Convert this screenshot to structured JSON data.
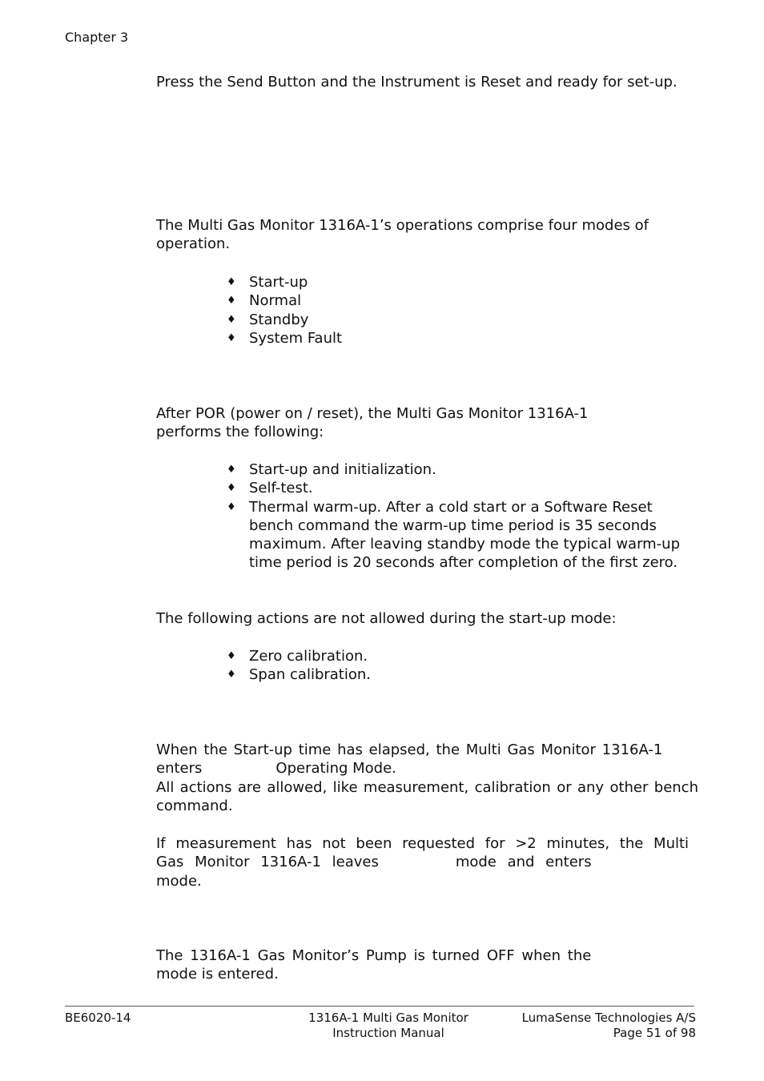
{
  "header": {
    "chapter": "Chapter 3"
  },
  "intro": {
    "reset_text": "Press the Send Button and the Instrument is Reset and ready for set-up."
  },
  "modes_section": {
    "intro": "The Multi Gas Monitor 1316A-1’s operations comprise four modes of operation.",
    "bullet_glyph": "♦",
    "modes": [
      "Start-up",
      "Normal",
      "Standby",
      "System Fault"
    ]
  },
  "startup_section": {
    "intro": "After POR (power on / reset), the Multi Gas Monitor 1316A-1 performs the following:",
    "steps": [
      "Start-up and initialization.",
      "Self-test.",
      "Thermal warm-up. After a cold start or a Software Reset bench command the warm-up time period is 35 seconds maximum. After leaving standby mode the typical warm-up time period is 20 seconds after completion of the first zero."
    ],
    "not_allowed_intro": "The following actions are not allowed during the start-up mode:",
    "not_allowed": [
      "Zero calibration.",
      "Span calibration."
    ]
  },
  "normal_section": {
    "line1": "When the Start-up time has elapsed, the Multi Gas Monitor 1316A-1",
    "line2_a": "enters",
    "line2_b": "Operating Mode.",
    "allowed": "All actions are allowed, like measurement, calibration or any other bench command.",
    "idle_line1": "If measurement has not been requested for >2 minutes, the Multi",
    "idle_line2_a": "Gas Monitor 1316A-1 leaves",
    "idle_line2_b": "mode and enters",
    "idle_line3": "mode."
  },
  "standby_section": {
    "line1": "The 1316A-1 Gas Monitor’s Pump is turned OFF when the",
    "line2": "mode is entered."
  },
  "footer": {
    "doc_code": "BE6020-14",
    "product": "1316A-1 Multi Gas Monitor",
    "manual": "Instruction Manual",
    "company": "LumaSense Technologies A/S",
    "page": "Page 51 of 98"
  }
}
